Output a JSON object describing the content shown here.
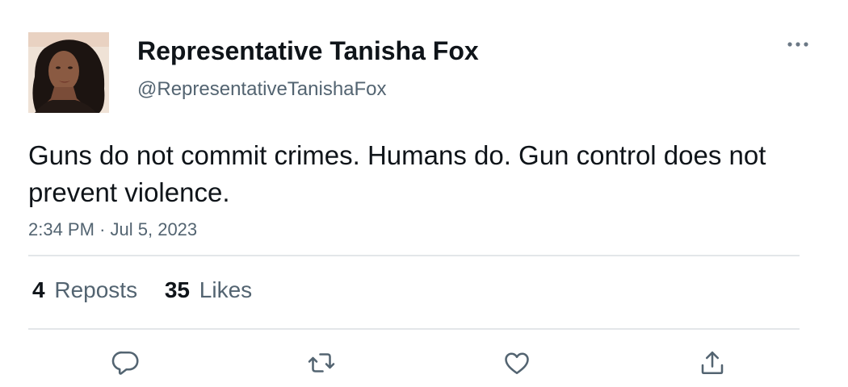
{
  "author": {
    "display_name": "Representative Tanisha Fox",
    "handle": "@RepresentativeTanishaFox",
    "avatar_icon": "profile-photo"
  },
  "tweet": {
    "text": "Guns do not commit crimes. Humans do. Gun control does not prevent violence.",
    "time": "2:34 PM",
    "separator": "·",
    "date": "Jul 5, 2023"
  },
  "stats": {
    "reposts_count": "4",
    "reposts_label": "Reposts",
    "likes_count": "35",
    "likes_label": "Likes"
  },
  "actions": {
    "reply_icon": "reply-icon",
    "repost_icon": "repost-icon",
    "like_icon": "heart-icon",
    "share_icon": "share-icon"
  },
  "colors": {
    "primary_text": "#0f1419",
    "secondary_text": "#536471",
    "divider": "#e3e6e9",
    "background": "#ffffff"
  }
}
